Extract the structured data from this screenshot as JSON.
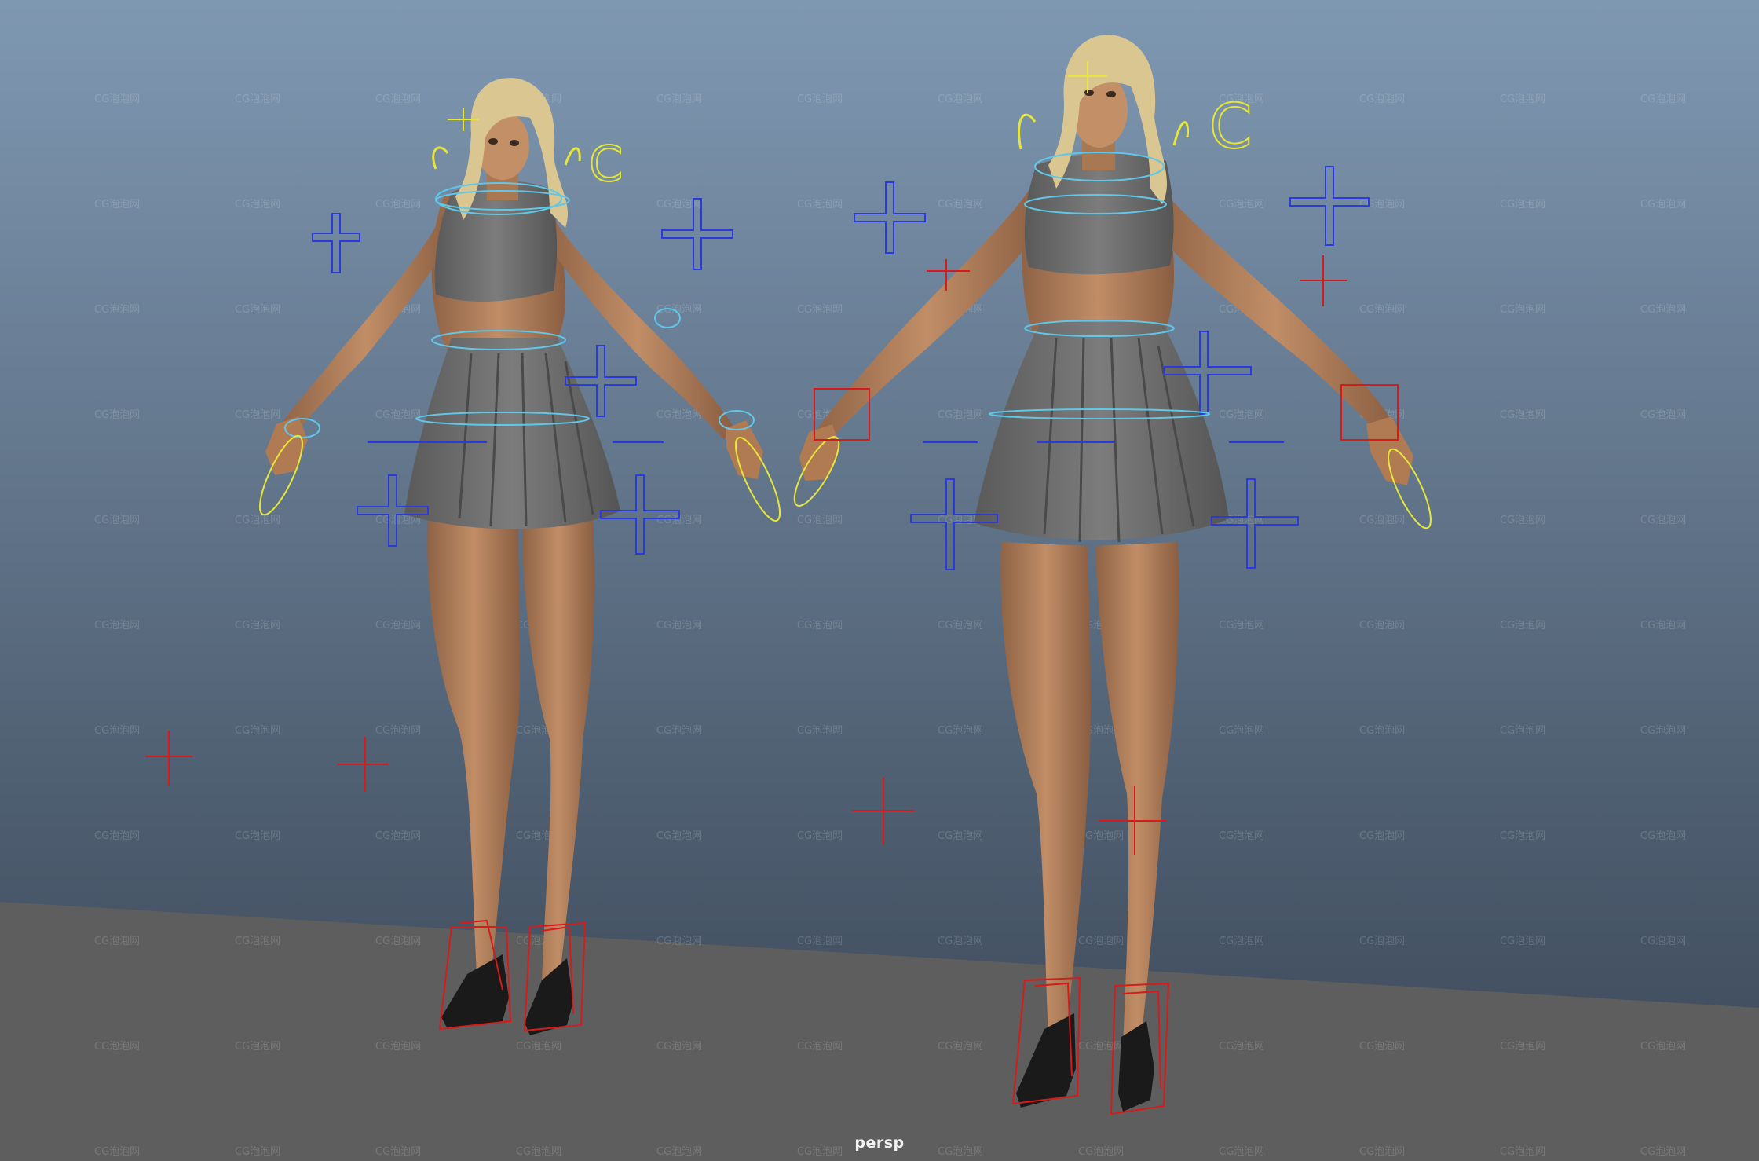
{
  "viewport": {
    "camera_name": "persp",
    "watermark_text": "CG泡泡网",
    "colors": {
      "sky_top": "#7f98b2",
      "sky_bottom": "#3e4c5c",
      "floor": "#5e5e5e",
      "controller_blue": "#2a3ae0",
      "controller_yellow": "#e6e63a",
      "controller_cyan": "#5fc7e8",
      "controller_red": "#d81a1a",
      "skin": "#b5835c",
      "garment": "#6f6f6f",
      "hair": "#d9c690"
    }
  },
  "scene": {
    "objects": [
      "character-rig-left",
      "character-rig-right"
    ]
  }
}
